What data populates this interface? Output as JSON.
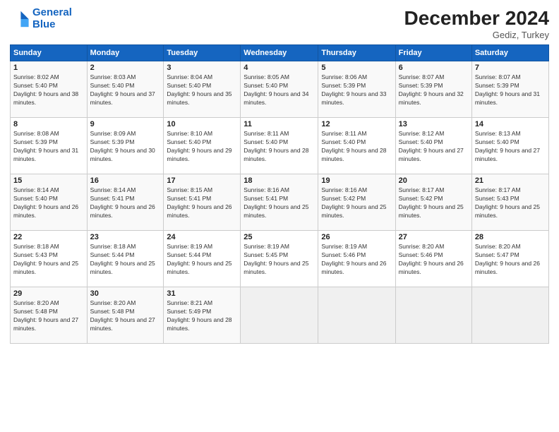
{
  "logo": {
    "line1": "General",
    "line2": "Blue"
  },
  "title": {
    "month": "December 2024",
    "location": "Gediz, Turkey"
  },
  "headers": [
    "Sunday",
    "Monday",
    "Tuesday",
    "Wednesday",
    "Thursday",
    "Friday",
    "Saturday"
  ],
  "weeks": [
    [
      {
        "day": "1",
        "sunrise": "Sunrise: 8:02 AM",
        "sunset": "Sunset: 5:40 PM",
        "daylight": "Daylight: 9 hours and 38 minutes."
      },
      {
        "day": "2",
        "sunrise": "Sunrise: 8:03 AM",
        "sunset": "Sunset: 5:40 PM",
        "daylight": "Daylight: 9 hours and 37 minutes."
      },
      {
        "day": "3",
        "sunrise": "Sunrise: 8:04 AM",
        "sunset": "Sunset: 5:40 PM",
        "daylight": "Daylight: 9 hours and 35 minutes."
      },
      {
        "day": "4",
        "sunrise": "Sunrise: 8:05 AM",
        "sunset": "Sunset: 5:40 PM",
        "daylight": "Daylight: 9 hours and 34 minutes."
      },
      {
        "day": "5",
        "sunrise": "Sunrise: 8:06 AM",
        "sunset": "Sunset: 5:39 PM",
        "daylight": "Daylight: 9 hours and 33 minutes."
      },
      {
        "day": "6",
        "sunrise": "Sunrise: 8:07 AM",
        "sunset": "Sunset: 5:39 PM",
        "daylight": "Daylight: 9 hours and 32 minutes."
      },
      {
        "day": "7",
        "sunrise": "Sunrise: 8:07 AM",
        "sunset": "Sunset: 5:39 PM",
        "daylight": "Daylight: 9 hours and 31 minutes."
      }
    ],
    [
      {
        "day": "8",
        "sunrise": "Sunrise: 8:08 AM",
        "sunset": "Sunset: 5:39 PM",
        "daylight": "Daylight: 9 hours and 31 minutes."
      },
      {
        "day": "9",
        "sunrise": "Sunrise: 8:09 AM",
        "sunset": "Sunset: 5:39 PM",
        "daylight": "Daylight: 9 hours and 30 minutes."
      },
      {
        "day": "10",
        "sunrise": "Sunrise: 8:10 AM",
        "sunset": "Sunset: 5:40 PM",
        "daylight": "Daylight: 9 hours and 29 minutes."
      },
      {
        "day": "11",
        "sunrise": "Sunrise: 8:11 AM",
        "sunset": "Sunset: 5:40 PM",
        "daylight": "Daylight: 9 hours and 28 minutes."
      },
      {
        "day": "12",
        "sunrise": "Sunrise: 8:11 AM",
        "sunset": "Sunset: 5:40 PM",
        "daylight": "Daylight: 9 hours and 28 minutes."
      },
      {
        "day": "13",
        "sunrise": "Sunrise: 8:12 AM",
        "sunset": "Sunset: 5:40 PM",
        "daylight": "Daylight: 9 hours and 27 minutes."
      },
      {
        "day": "14",
        "sunrise": "Sunrise: 8:13 AM",
        "sunset": "Sunset: 5:40 PM",
        "daylight": "Daylight: 9 hours and 27 minutes."
      }
    ],
    [
      {
        "day": "15",
        "sunrise": "Sunrise: 8:14 AM",
        "sunset": "Sunset: 5:40 PM",
        "daylight": "Daylight: 9 hours and 26 minutes."
      },
      {
        "day": "16",
        "sunrise": "Sunrise: 8:14 AM",
        "sunset": "Sunset: 5:41 PM",
        "daylight": "Daylight: 9 hours and 26 minutes."
      },
      {
        "day": "17",
        "sunrise": "Sunrise: 8:15 AM",
        "sunset": "Sunset: 5:41 PM",
        "daylight": "Daylight: 9 hours and 26 minutes."
      },
      {
        "day": "18",
        "sunrise": "Sunrise: 8:16 AM",
        "sunset": "Sunset: 5:41 PM",
        "daylight": "Daylight: 9 hours and 25 minutes."
      },
      {
        "day": "19",
        "sunrise": "Sunrise: 8:16 AM",
        "sunset": "Sunset: 5:42 PM",
        "daylight": "Daylight: 9 hours and 25 minutes."
      },
      {
        "day": "20",
        "sunrise": "Sunrise: 8:17 AM",
        "sunset": "Sunset: 5:42 PM",
        "daylight": "Daylight: 9 hours and 25 minutes."
      },
      {
        "day": "21",
        "sunrise": "Sunrise: 8:17 AM",
        "sunset": "Sunset: 5:43 PM",
        "daylight": "Daylight: 9 hours and 25 minutes."
      }
    ],
    [
      {
        "day": "22",
        "sunrise": "Sunrise: 8:18 AM",
        "sunset": "Sunset: 5:43 PM",
        "daylight": "Daylight: 9 hours and 25 minutes."
      },
      {
        "day": "23",
        "sunrise": "Sunrise: 8:18 AM",
        "sunset": "Sunset: 5:44 PM",
        "daylight": "Daylight: 9 hours and 25 minutes."
      },
      {
        "day": "24",
        "sunrise": "Sunrise: 8:19 AM",
        "sunset": "Sunset: 5:44 PM",
        "daylight": "Daylight: 9 hours and 25 minutes."
      },
      {
        "day": "25",
        "sunrise": "Sunrise: 8:19 AM",
        "sunset": "Sunset: 5:45 PM",
        "daylight": "Daylight: 9 hours and 25 minutes."
      },
      {
        "day": "26",
        "sunrise": "Sunrise: 8:19 AM",
        "sunset": "Sunset: 5:46 PM",
        "daylight": "Daylight: 9 hours and 26 minutes."
      },
      {
        "day": "27",
        "sunrise": "Sunrise: 8:20 AM",
        "sunset": "Sunset: 5:46 PM",
        "daylight": "Daylight: 9 hours and 26 minutes."
      },
      {
        "day": "28",
        "sunrise": "Sunrise: 8:20 AM",
        "sunset": "Sunset: 5:47 PM",
        "daylight": "Daylight: 9 hours and 26 minutes."
      }
    ],
    [
      {
        "day": "29",
        "sunrise": "Sunrise: 8:20 AM",
        "sunset": "Sunset: 5:48 PM",
        "daylight": "Daylight: 9 hours and 27 minutes."
      },
      {
        "day": "30",
        "sunrise": "Sunrise: 8:20 AM",
        "sunset": "Sunset: 5:48 PM",
        "daylight": "Daylight: 9 hours and 27 minutes."
      },
      {
        "day": "31",
        "sunrise": "Sunrise: 8:21 AM",
        "sunset": "Sunset: 5:49 PM",
        "daylight": "Daylight: 9 hours and 28 minutes."
      },
      null,
      null,
      null,
      null
    ]
  ]
}
